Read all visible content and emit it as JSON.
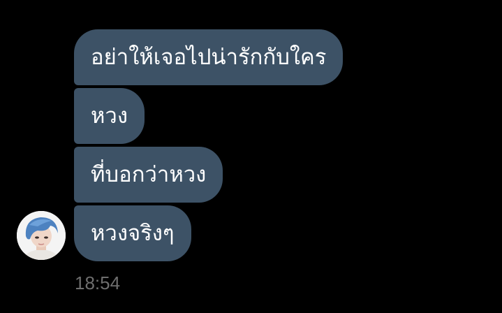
{
  "conversation": {
    "messages": [
      {
        "text": "อย่าให้เจอไปน่ารักกับใคร"
      },
      {
        "text": "หวง"
      },
      {
        "text": "ที่บอกว่าหวง"
      },
      {
        "text": "หวงจริงๆ"
      }
    ],
    "timestamp": "18:54",
    "avatar_icon": "profile-photo",
    "colors": {
      "background": "#000000",
      "bubble": "#3d5266",
      "text": "#ffffff",
      "timestamp": "#6e6e6e"
    }
  }
}
